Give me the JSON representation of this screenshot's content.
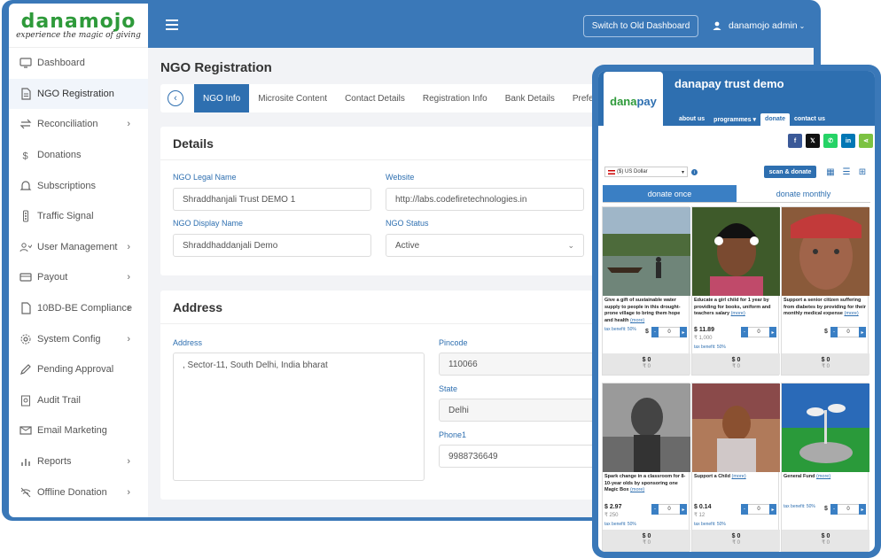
{
  "admin": {
    "logo": "danamojo",
    "tagline": "experience the magic of giving",
    "menu": [
      {
        "label": "Dashboard",
        "icon": "monitor-icon",
        "chevron": false
      },
      {
        "label": "NGO Registration",
        "icon": "document-icon",
        "chevron": false
      },
      {
        "label": "Reconciliation",
        "icon": "arrows-icon",
        "chevron": true
      },
      {
        "label": "Donations",
        "icon": "dollar-icon",
        "chevron": false
      },
      {
        "label": "Subscriptions",
        "icon": "bell-icon",
        "chevron": false
      },
      {
        "label": "Traffic Signal",
        "icon": "traffic-light-icon",
        "chevron": false
      },
      {
        "label": "User Management",
        "icon": "users-icon",
        "chevron": true
      },
      {
        "label": "Payout",
        "icon": "card-icon",
        "chevron": true
      },
      {
        "label": "10BD-BE Compliance",
        "icon": "file-icon",
        "chevron": true
      },
      {
        "label": "System Config",
        "icon": "gear-icon",
        "chevron": true
      },
      {
        "label": "Pending Approval",
        "icon": "edit-icon",
        "chevron": false
      },
      {
        "label": "Audit Trail",
        "icon": "audit-icon",
        "chevron": false
      },
      {
        "label": "Email Marketing",
        "icon": "mail-icon",
        "chevron": false
      },
      {
        "label": "Reports",
        "icon": "bar-chart-icon",
        "chevron": true
      },
      {
        "label": "Offline Donation",
        "icon": "no-wifi-icon",
        "chevron": true
      }
    ],
    "switch_label": "Switch to Old Dashboard",
    "user_label": "danamojo admin",
    "page_title": "NGO Registration",
    "tabs": [
      "NGO Info",
      "Microsite Content",
      "Contact Details",
      "Registration Info",
      "Bank Details",
      "Prefe"
    ],
    "details": {
      "heading": "Details",
      "legal_name_label": "NGO Legal Name",
      "legal_name_value": "Shraddhanjali Trust DEMO 1",
      "website_label": "Website",
      "website_value": "http://labs.codefiretechnologies.in",
      "display_name_label": "NGO Display Name",
      "display_name_value": "Shraddhaddanjali Demo",
      "status_label": "NGO Status",
      "status_value": "Active"
    },
    "address": {
      "heading": "Address",
      "address_label": "Address",
      "address_value": ", Sector-11, South Delhi, India bharat",
      "pincode_label": "Pincode",
      "pincode_value": "110066",
      "state_label": "State",
      "state_value": "Delhi",
      "phone_label": "Phone1",
      "phone_value": "9988736649"
    }
  },
  "mobile": {
    "logo_part1": "dana",
    "logo_part2": "pay",
    "title": "danapay trust demo",
    "nav": [
      "about us",
      "programmes",
      "donate",
      "contact us"
    ],
    "currency": "($) US Dollar",
    "scan_donate": "scan & donate",
    "donate_once": "donate once",
    "donate_monthly": "donate monthly",
    "more": "(more)",
    "products": [
      {
        "desc": "Give a gift of sustainable water supply to people in this drought-prone village to bring them hope and health",
        "price": "",
        "price_alt": "",
        "tax": "tax benefit: 50%",
        "qty": "0",
        "total": "$ 0",
        "total_alt": "₹ 0"
      },
      {
        "desc": "Educate a girl child for 1 year by providing for books, uniform and teachers salary",
        "price": "$ 11.89",
        "price_alt": "₹ 1,000",
        "tax": "tax benefit: 50%",
        "qty": "0",
        "total": "$ 0",
        "total_alt": "₹ 0"
      },
      {
        "desc": "Support a senior citizen suffering from diabetes by providing for their monthly medical expense",
        "price": "",
        "price_alt": "",
        "tax": "",
        "qty": "0",
        "total": "$ 0",
        "total_alt": "₹ 0"
      },
      {
        "desc": "Spark change in a classroom for 8-10-year olds by sponsoring one Magic Box",
        "price": "$ 2.97",
        "price_alt": "₹ 250",
        "tax": "tax benefit: 50%",
        "qty": "0",
        "total": "$ 0",
        "total_alt": "₹ 0"
      },
      {
        "desc": "Support a Child",
        "price": "$ 0.14",
        "price_alt": "₹ 12",
        "tax": "tax benefit: 50%",
        "qty": "0",
        "total": "$ 0",
        "total_alt": "₹ 0"
      },
      {
        "desc": "General Fund",
        "price": "",
        "price_alt": "",
        "tax": "tax benefit: 50%",
        "qty": "0",
        "total": "$ 0",
        "total_alt": "₹ 0"
      }
    ],
    "colors": {
      "primary": "#2e6fb0",
      "green": "#2e9a3a"
    }
  }
}
